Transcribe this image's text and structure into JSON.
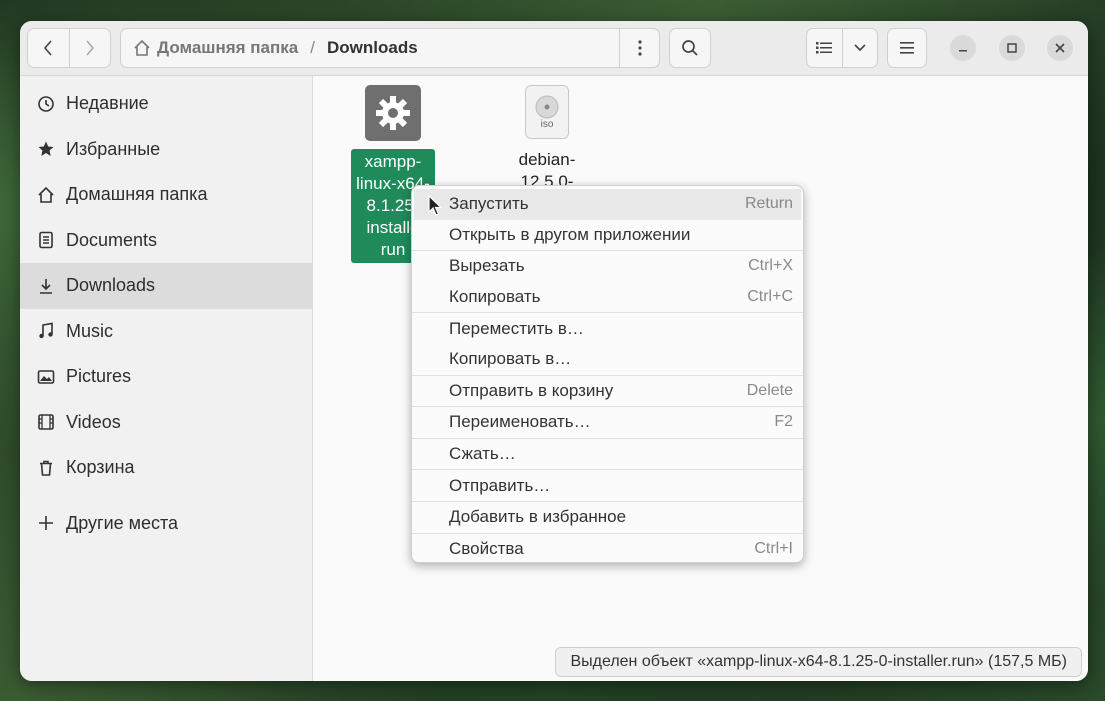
{
  "header": {
    "back_icon": "chevron-left-icon",
    "forward_icon": "chevron-right-icon",
    "path": [
      "Домашняя папка",
      "Downloads"
    ],
    "path_separator": "/",
    "path_menu_icon": "vertical-dots-icon",
    "search_icon": "search-icon",
    "view_icon": "list-view-icon",
    "view_dropdown_icon": "chevron-down-icon",
    "menu_icon": "hamburger-icon",
    "minimize_icon": "minimize-icon",
    "maximize_icon": "maximize-icon",
    "close_icon": "close-icon"
  },
  "sidebar": {
    "items": [
      {
        "label": "Недавние",
        "icon": "clock-icon"
      },
      {
        "label": "Избранные",
        "icon": "star-icon"
      },
      {
        "label": "Домашняя папка",
        "icon": "home-icon"
      },
      {
        "label": "Documents",
        "icon": "document-icon"
      },
      {
        "label": "Downloads",
        "icon": "download-icon",
        "active": true
      },
      {
        "label": "Music",
        "icon": "music-icon"
      },
      {
        "label": "Pictures",
        "icon": "picture-icon"
      },
      {
        "label": "Videos",
        "icon": "video-icon"
      },
      {
        "label": "Корзина",
        "icon": "trash-icon"
      }
    ],
    "other_places": {
      "label": "Другие места",
      "icon": "plus-icon"
    }
  },
  "files": [
    {
      "name_lines": [
        "xampp-",
        "linux-x64-",
        "8.1.25-",
        "installe",
        "run"
      ],
      "icon": "gear-icon",
      "selected": true
    },
    {
      "name_lines": [
        "debian-",
        "12.5.0-"
      ],
      "icon": "iso-disc-icon",
      "icon_label": "iso",
      "selected": false
    }
  ],
  "context_menu": {
    "groups": [
      [
        {
          "label": "Запустить",
          "accel": "Return",
          "highlighted": true
        },
        {
          "label": "Открыть в другом приложении",
          "accel": ""
        }
      ],
      [
        {
          "label": "Вырезать",
          "accel": "Ctrl+X"
        },
        {
          "label": "Копировать",
          "accel": "Ctrl+C"
        }
      ],
      [
        {
          "label": "Переместить в…",
          "accel": ""
        },
        {
          "label": "Копировать в…",
          "accel": ""
        }
      ],
      [
        {
          "label": "Отправить в корзину",
          "accel": "Delete"
        }
      ],
      [
        {
          "label": "Переименовать…",
          "accel": "F2"
        }
      ],
      [
        {
          "label": "Сжать…",
          "accel": ""
        }
      ],
      [
        {
          "label": "Отправить…",
          "accel": ""
        }
      ],
      [
        {
          "label": "Добавить в избранное",
          "accel": ""
        }
      ],
      [
        {
          "label": "Свойства",
          "accel": "Ctrl+I"
        }
      ]
    ]
  },
  "status": {
    "text": "Выделен объект «xampp-linux-x64-8.1.25-0-installer.run»  (157,5 МБ)"
  },
  "colors": {
    "selection": "#1f8a5a",
    "sidebar_active": "#dcdcdc",
    "headerbar": "#ebebeb"
  }
}
